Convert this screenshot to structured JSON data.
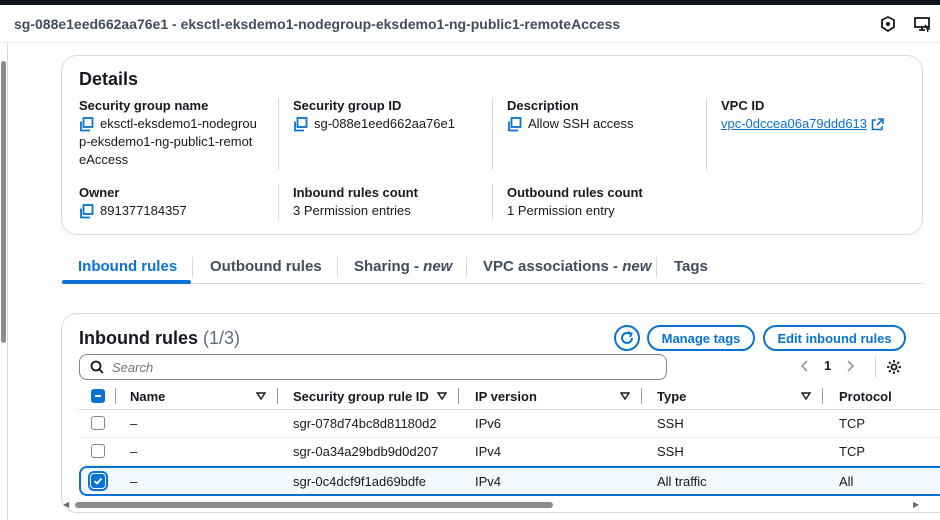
{
  "header": {
    "title": "sg-088e1eed662aa76e1 - eksctl-eksdemo1-nodegroup-eksdemo1-ng-public1-remoteAccess"
  },
  "details": {
    "title": "Details",
    "security_group_name_label": "Security group name",
    "security_group_name_lines": [
      "eksctl-eksdemo1-nodegrou",
      "p-eksdemo1-ng-public1-remot",
      "eAccess"
    ],
    "security_group_id_label": "Security group ID",
    "security_group_id": "sg-088e1eed662aa76e1",
    "description_label": "Description",
    "description": "Allow SSH access",
    "vpc_id_label": "VPC ID",
    "vpc_id": "vpc-0dccea06a79ddd613",
    "owner_label": "Owner",
    "owner": "891377184357",
    "inbound_count_label": "Inbound rules count",
    "inbound_count": "3 Permission entries",
    "outbound_count_label": "Outbound rules count",
    "outbound_count": "1 Permission entry"
  },
  "tabs": [
    {
      "label": "Inbound rules",
      "suffix": "",
      "active": true
    },
    {
      "label": "Outbound rules",
      "suffix": "",
      "active": false
    },
    {
      "label": "Sharing - ",
      "suffix": "new",
      "active": false
    },
    {
      "label": "VPC associations - ",
      "suffix": "new",
      "active": false
    },
    {
      "label": "Tags",
      "suffix": "",
      "active": false
    }
  ],
  "inbound": {
    "title": "Inbound rules",
    "count": "(1/3)",
    "manage_tags_label": "Manage tags",
    "edit_label": "Edit inbound rules",
    "search_placeholder": "Search",
    "page": "1",
    "columns": [
      "Name",
      "Security group rule ID",
      "IP version",
      "Type",
      "Protocol"
    ],
    "rows": [
      {
        "name": "–",
        "rule_id": "sgr-078d74bc8d81180d2",
        "ip_version": "IPv6",
        "type": "SSH",
        "protocol": "TCP",
        "selected": false
      },
      {
        "name": "–",
        "rule_id": "sgr-0a34a29bdb9d0d207",
        "ip_version": "IPv4",
        "type": "SSH",
        "protocol": "TCP",
        "selected": false
      },
      {
        "name": "–",
        "rule_id": "sgr-0c4dcf9f1ad69bdfe",
        "ip_version": "IPv4",
        "type": "All traffic",
        "protocol": "All",
        "selected": true
      }
    ]
  },
  "colors": {
    "accent": "#0972d3",
    "text": "#16191f",
    "border": "#d5dbdb",
    "selected_bg": "#f2f8fd"
  },
  "icons": [
    "shield-icon",
    "remote-desktop-icon",
    "copy-icon",
    "external-link-icon",
    "refresh-icon",
    "search-icon",
    "chevron-left-icon",
    "chevron-right-icon",
    "settings-gear-icon",
    "sort-caret-icon"
  ]
}
